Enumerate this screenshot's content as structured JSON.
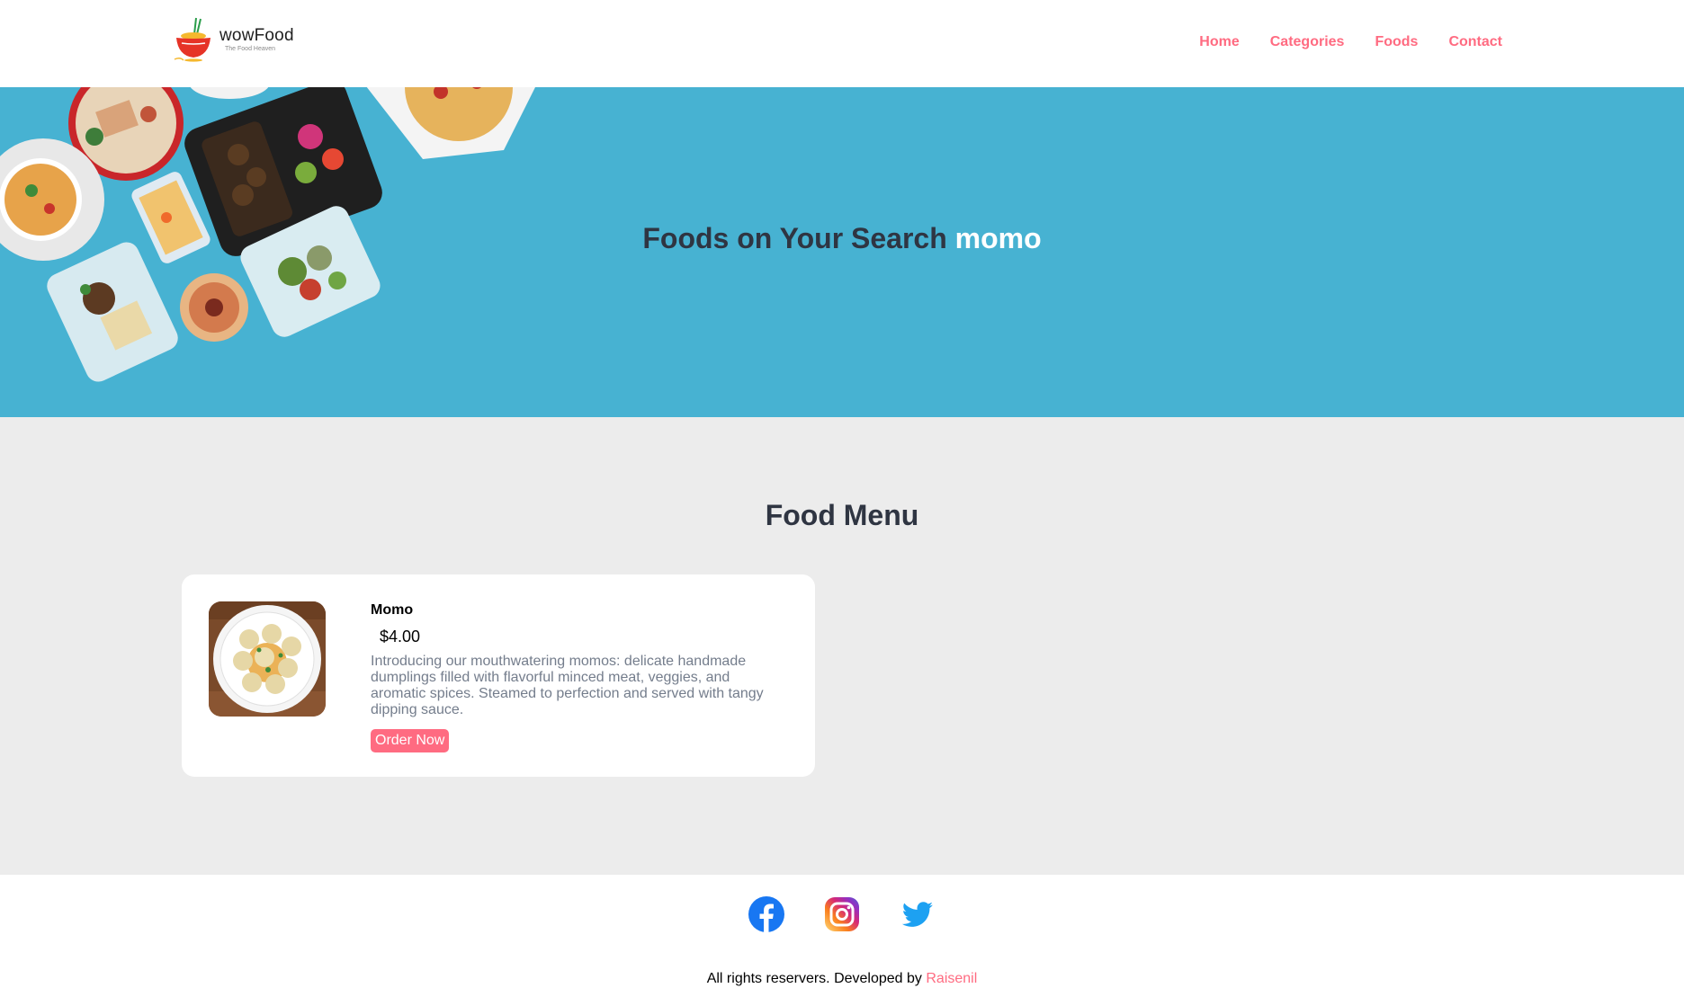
{
  "brand": {
    "name": "wowFood",
    "tagline": "The Food Heaven"
  },
  "nav": {
    "items": [
      {
        "label": "Home"
      },
      {
        "label": "Categories"
      },
      {
        "label": "Foods"
      },
      {
        "label": "Contact"
      }
    ]
  },
  "hero": {
    "title_prefix": "Foods on Your Search ",
    "query": "momo"
  },
  "menu": {
    "title": "Food Menu",
    "items": [
      {
        "name": "Momo",
        "price": "$4.00",
        "description": "Introducing our mouthwatering momos: delicate handmade dumplings filled with flavorful minced meat, veggies, and aromatic spices. Steamed to perfection and served with tangy dipping sauce.",
        "button": "Order Now"
      }
    ]
  },
  "social": {
    "icons": [
      "facebook-icon",
      "instagram-icon",
      "twitter-icon"
    ]
  },
  "footer": {
    "text": "All rights reservers. Developed by ",
    "author": "Raisenil"
  },
  "colors": {
    "accent": "#ff6b81",
    "hero_bg": "#47b2d2",
    "menu_bg": "#ececec",
    "heading": "#2f3542",
    "description": "#747d8c"
  }
}
